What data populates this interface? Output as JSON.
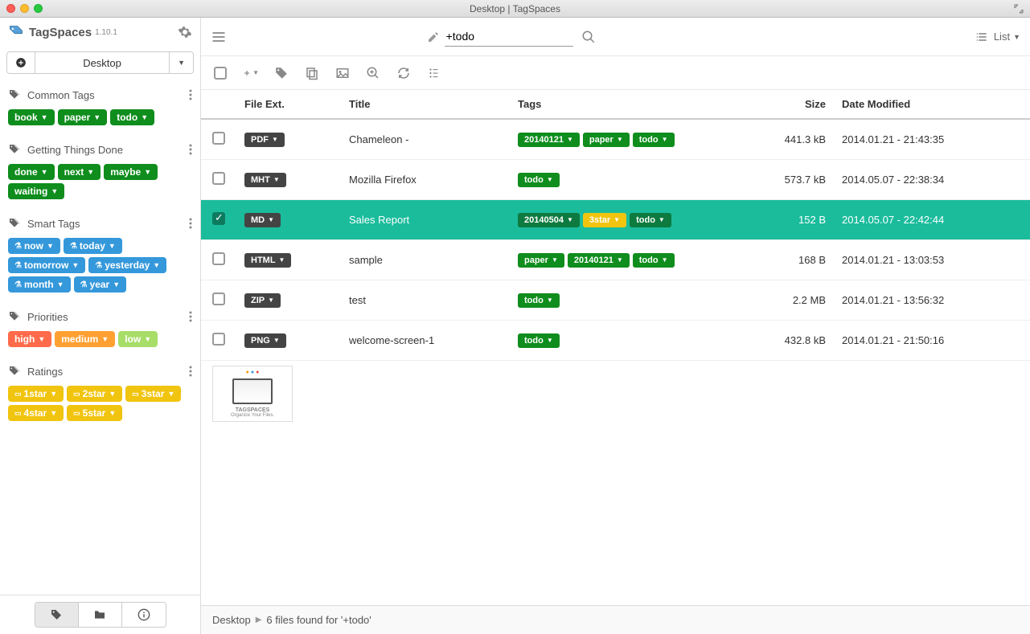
{
  "window_title": "Desktop | TagSpaces",
  "brand": "TagSpaces",
  "version": "1.10.1",
  "location": "Desktop",
  "search": {
    "value": "+todo"
  },
  "view_mode": "List",
  "sidebar": {
    "groups": [
      {
        "name": "Common Tags",
        "tags": [
          {
            "label": "book",
            "cls": "tag-green"
          },
          {
            "label": "paper",
            "cls": "tag-green"
          },
          {
            "label": "todo",
            "cls": "tag-green"
          }
        ]
      },
      {
        "name": "Getting Things Done",
        "tags": [
          {
            "label": "done",
            "cls": "tag-green"
          },
          {
            "label": "next",
            "cls": "tag-green"
          },
          {
            "label": "maybe",
            "cls": "tag-green"
          },
          {
            "label": "waiting",
            "cls": "tag-green"
          }
        ]
      },
      {
        "name": "Smart Tags",
        "tags": [
          {
            "label": "now",
            "cls": "tag-blue",
            "icon": "flask"
          },
          {
            "label": "today",
            "cls": "tag-blue",
            "icon": "flask"
          },
          {
            "label": "tomorrow",
            "cls": "tag-blue",
            "icon": "flask"
          },
          {
            "label": "yesterday",
            "cls": "tag-blue",
            "icon": "flask"
          },
          {
            "label": "month",
            "cls": "tag-blue",
            "icon": "flask"
          },
          {
            "label": "year",
            "cls": "tag-blue",
            "icon": "flask"
          }
        ]
      },
      {
        "name": "Priorities",
        "tags": [
          {
            "label": "high",
            "cls": "tag-prio-high"
          },
          {
            "label": "medium",
            "cls": "tag-prio-med"
          },
          {
            "label": "low",
            "cls": "tag-prio-low"
          }
        ]
      },
      {
        "name": "Ratings",
        "tags": [
          {
            "label": "1star",
            "cls": "tag-rating",
            "icon": "star"
          },
          {
            "label": "2star",
            "cls": "tag-rating",
            "icon": "star"
          },
          {
            "label": "3star",
            "cls": "tag-rating",
            "icon": "star"
          },
          {
            "label": "4star",
            "cls": "tag-rating",
            "icon": "star"
          },
          {
            "label": "5star",
            "cls": "tag-rating",
            "icon": "star"
          }
        ]
      }
    ]
  },
  "columns": {
    "ext": "File Ext.",
    "title": "Title",
    "tags": "Tags",
    "size": "Size",
    "date": "Date Modified"
  },
  "files": [
    {
      "ext": "PDF",
      "title": "Chameleon -",
      "tags": [
        {
          "label": "20140121",
          "cls": "ftag-green"
        },
        {
          "label": "paper",
          "cls": "ftag-green"
        },
        {
          "label": "todo",
          "cls": "ftag-green"
        }
      ],
      "size": "441.3 kB",
      "date": "2014.01.21 - 21:43:35",
      "selected": false
    },
    {
      "ext": "MHT",
      "title": "Mozilla Firefox",
      "tags": [
        {
          "label": "todo",
          "cls": "ftag-green"
        }
      ],
      "size": "573.7 kB",
      "date": "2014.05.07 - 22:38:34",
      "selected": false
    },
    {
      "ext": "MD",
      "title": "Sales Report",
      "tags": [
        {
          "label": "20140504",
          "cls": "ftag-green-sel"
        },
        {
          "label": "3star",
          "cls": "ftag-yellow"
        },
        {
          "label": "todo",
          "cls": "ftag-green-sel"
        }
      ],
      "size": "152 B",
      "date": "2014.05.07 - 22:42:44",
      "selected": true
    },
    {
      "ext": "HTML",
      "title": "sample",
      "tags": [
        {
          "label": "paper",
          "cls": "ftag-green"
        },
        {
          "label": "20140121",
          "cls": "ftag-green"
        },
        {
          "label": "todo",
          "cls": "ftag-green"
        }
      ],
      "size": "168 B",
      "date": "2014.01.21 - 13:03:53",
      "selected": false
    },
    {
      "ext": "ZIP",
      "title": "test",
      "tags": [
        {
          "label": "todo",
          "cls": "ftag-green"
        }
      ],
      "size": "2.2 MB",
      "date": "2014.01.21 - 13:56:32",
      "selected": false
    },
    {
      "ext": "PNG",
      "title": "welcome-screen-1",
      "tags": [
        {
          "label": "todo",
          "cls": "ftag-green"
        }
      ],
      "size": "432.8 kB",
      "date": "2014.01.21 - 21:50:16",
      "selected": false,
      "thumb": true
    }
  ],
  "thumb_caption1": "TAGSPACES",
  "thumb_caption2": "Organize Your Files.",
  "status": {
    "crumb": "Desktop",
    "message": "6 files found for '+todo'"
  }
}
